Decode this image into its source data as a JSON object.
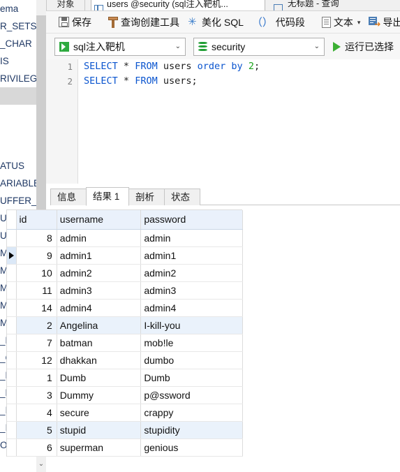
{
  "window": {
    "tabs": {
      "object_tab": "对象",
      "query_tab": "users @security (sql注入靶机...",
      "untitled_tab": "无标题 - 查询",
      "query_tab_icon": "grid-table-icon",
      "untitled_tab_icon": "grid-table-icon"
    }
  },
  "sidebar": {
    "header": "ema",
    "items": [
      "R_SETS",
      "_CHAR",
      "IS",
      "RIVILEG",
      "",
      "",
      "",
      "",
      "ATUS",
      "ARIABLE",
      "UFFER_P",
      "UFFER_P",
      "UFFER_P",
      "MP",
      "MP_PER",
      "MP_PER",
      "MP_RES",
      "MPMEM",
      "_BEING",
      "_CONFI",
      "_DEFAU",
      "_DELET",
      "_INDEX",
      "_INDEX",
      "OCK_WA"
    ],
    "scroll_down_icon": "chevron-down-icon"
  },
  "toolbar": {
    "buttons": [
      {
        "label": "保存",
        "icon": "save-icon"
      },
      {
        "label": "查询创建工具",
        "icon": "query-builder-icon"
      },
      {
        "label": "美化 SQL",
        "icon": "magic-wand-icon"
      },
      {
        "label": "代码段",
        "icon": "code-snippet-icon"
      },
      {
        "label": "文本",
        "icon": "text-file-icon",
        "has_caret": true
      },
      {
        "label": "导出",
        "icon": "export-icon"
      }
    ],
    "paren_glyph": "（）",
    "caret_glyph": "▾"
  },
  "connbar": {
    "connection": {
      "value": "sql注入靶机",
      "icon": "connection-icon",
      "caret": "⌄"
    },
    "database": {
      "value": "security",
      "icon": "database-icon",
      "caret": "⌄"
    },
    "run_button": {
      "label": "运行已选择",
      "icon": "play-icon"
    }
  },
  "editor": {
    "line_numbers": [
      "1",
      "2"
    ],
    "lines": [
      {
        "selected": true,
        "tokens": [
          {
            "t": "SELECT",
            "c": "kw"
          },
          {
            "t": " ",
            "c": "punc"
          },
          {
            "t": "*",
            "c": "star"
          },
          {
            "t": " ",
            "c": "punc"
          },
          {
            "t": "FROM",
            "c": "kw"
          },
          {
            "t": " ",
            "c": "punc"
          },
          {
            "t": "users",
            "c": "ident"
          },
          {
            "t": " ",
            "c": "punc"
          },
          {
            "t": "order",
            "c": "kw"
          },
          {
            "t": " ",
            "c": "punc"
          },
          {
            "t": "by",
            "c": "kw"
          },
          {
            "t": " ",
            "c": "punc"
          },
          {
            "t": "2",
            "c": "num"
          },
          {
            "t": ";",
            "c": "punc"
          }
        ]
      },
      {
        "selected": false,
        "tokens": [
          {
            "t": "SELECT",
            "c": "kw"
          },
          {
            "t": " ",
            "c": "punc"
          },
          {
            "t": "*",
            "c": "star"
          },
          {
            "t": " ",
            "c": "punc"
          },
          {
            "t": "FROM",
            "c": "kw"
          },
          {
            "t": " ",
            "c": "punc"
          },
          {
            "t": "users",
            "c": "ident"
          },
          {
            "t": ";",
            "c": "punc"
          }
        ]
      }
    ]
  },
  "results": {
    "tabs": [
      {
        "label": "信息",
        "active": false
      },
      {
        "label": "结果 1",
        "active": true
      },
      {
        "label": "剖析",
        "active": false
      },
      {
        "label": "状态",
        "active": false
      }
    ],
    "columns": [
      "id",
      "username",
      "password"
    ],
    "rows": [
      {
        "id": "8",
        "username": "admin",
        "password": "admin",
        "highlight": false,
        "current": false
      },
      {
        "id": "9",
        "username": "admin1",
        "password": "admin1",
        "highlight": false,
        "current": true
      },
      {
        "id": "10",
        "username": "admin2",
        "password": "admin2",
        "highlight": false,
        "current": false
      },
      {
        "id": "11",
        "username": "admin3",
        "password": "admin3",
        "highlight": false,
        "current": false
      },
      {
        "id": "14",
        "username": "admin4",
        "password": "admin4",
        "highlight": false,
        "current": false
      },
      {
        "id": "2",
        "username": "Angelina",
        "password": "I-kill-you",
        "highlight": true,
        "current": false
      },
      {
        "id": "7",
        "username": "batman",
        "password": "mob!le",
        "highlight": false,
        "current": false
      },
      {
        "id": "12",
        "username": "dhakkan",
        "password": "dumbo",
        "highlight": false,
        "current": false
      },
      {
        "id": "1",
        "username": "Dumb",
        "password": "Dumb",
        "highlight": false,
        "current": false
      },
      {
        "id": "3",
        "username": "Dummy",
        "password": "p@ssword",
        "highlight": false,
        "current": false
      },
      {
        "id": "4",
        "username": "secure",
        "password": "crappy",
        "highlight": false,
        "current": false
      },
      {
        "id": "5",
        "username": "stupid",
        "password": "stupidity",
        "highlight": true,
        "current": false
      },
      {
        "id": "6",
        "username": "superman",
        "password": "genious",
        "highlight": false,
        "current": false
      }
    ]
  },
  "colors": {
    "accent_blue": "#0b55cf",
    "selection_blue": "#cfe0f5",
    "header_blue": "#eaf1fb",
    "run_green": "#3cb034",
    "number_green": "#19a319"
  }
}
